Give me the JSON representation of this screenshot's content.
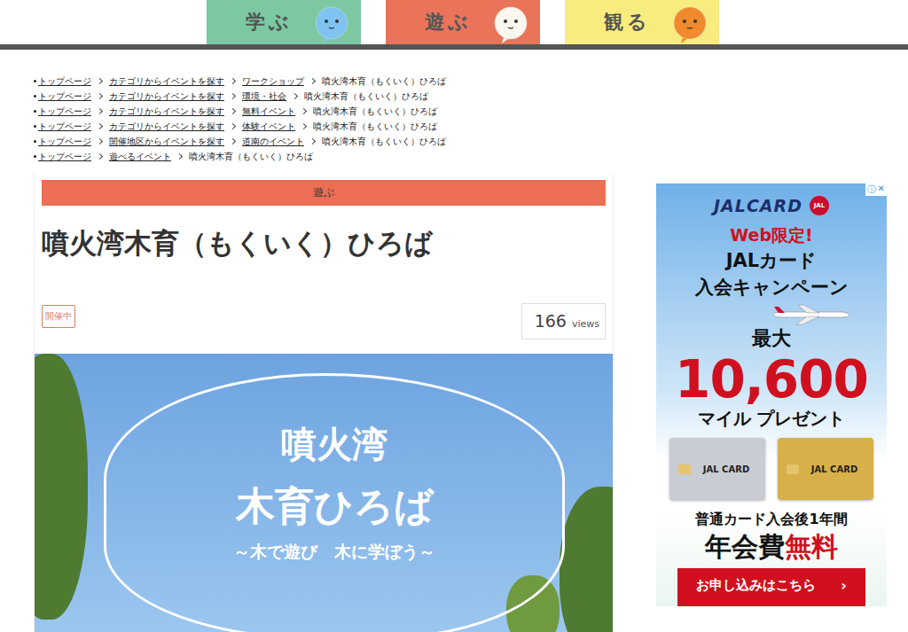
{
  "nav": [
    {
      "label": "学ぶ",
      "color": "#7cc8a2",
      "face": "#7fc4f0"
    },
    {
      "label": "遊ぶ",
      "color": "#e97459",
      "face": "#fbf6ee"
    },
    {
      "label": "観る",
      "color": "#f9ec7e",
      "face": "#f08a2c"
    }
  ],
  "breadcrumbs": [
    [
      "トップページ",
      "カテゴリからイベントを探す",
      "ワークショップ",
      "噴火湾木育（もくいく）ひろば"
    ],
    [
      "トップページ",
      "カテゴリからイベントを探す",
      "環境・社会",
      "噴火湾木育（もくいく）ひろば"
    ],
    [
      "トップページ",
      "カテゴリからイベントを探す",
      "無料イベント",
      "噴火湾木育（もくいく）ひろば"
    ],
    [
      "トップページ",
      "カテゴリからイベントを探す",
      "体験イベント",
      "噴火湾木育（もくいく）ひろば"
    ],
    [
      "トップページ",
      "開催地区からイベントを探す",
      "道南のイベント",
      "噴火湾木育（もくいく）ひろば"
    ],
    [
      "トップページ",
      "遊べるイベント",
      "噴火湾木育（もくいく）ひろば"
    ]
  ],
  "article": {
    "category": "遊ぶ",
    "title": "噴火湾木育（もくいく）ひろば",
    "badge": "開催中",
    "views_count": "166",
    "views_label": "views",
    "banner": {
      "line1": "噴火湾",
      "line2": "木育ひろば",
      "line3": "～木で遊び　木に学ぼう～"
    }
  },
  "ad": {
    "info": "ⓘ",
    "close": "✕",
    "logo": "JALCARD",
    "logo_mark": "JAL",
    "web": "Web限定!",
    "line1": "JALカード",
    "line2": "入会キャンペーン",
    "max": "最大",
    "amount": "10,600",
    "miles": "マイル プレゼント",
    "cards": [
      {
        "label": "JAL CARD",
        "color": "#c9ccd2"
      },
      {
        "label": "JAL CARD",
        "color": "#d8b04a"
      }
    ],
    "note": "普通カード入会後1年間",
    "fee": "年会費",
    "free": "無料",
    "button": "お申し込みはこちら",
    "arrow": "›"
  }
}
